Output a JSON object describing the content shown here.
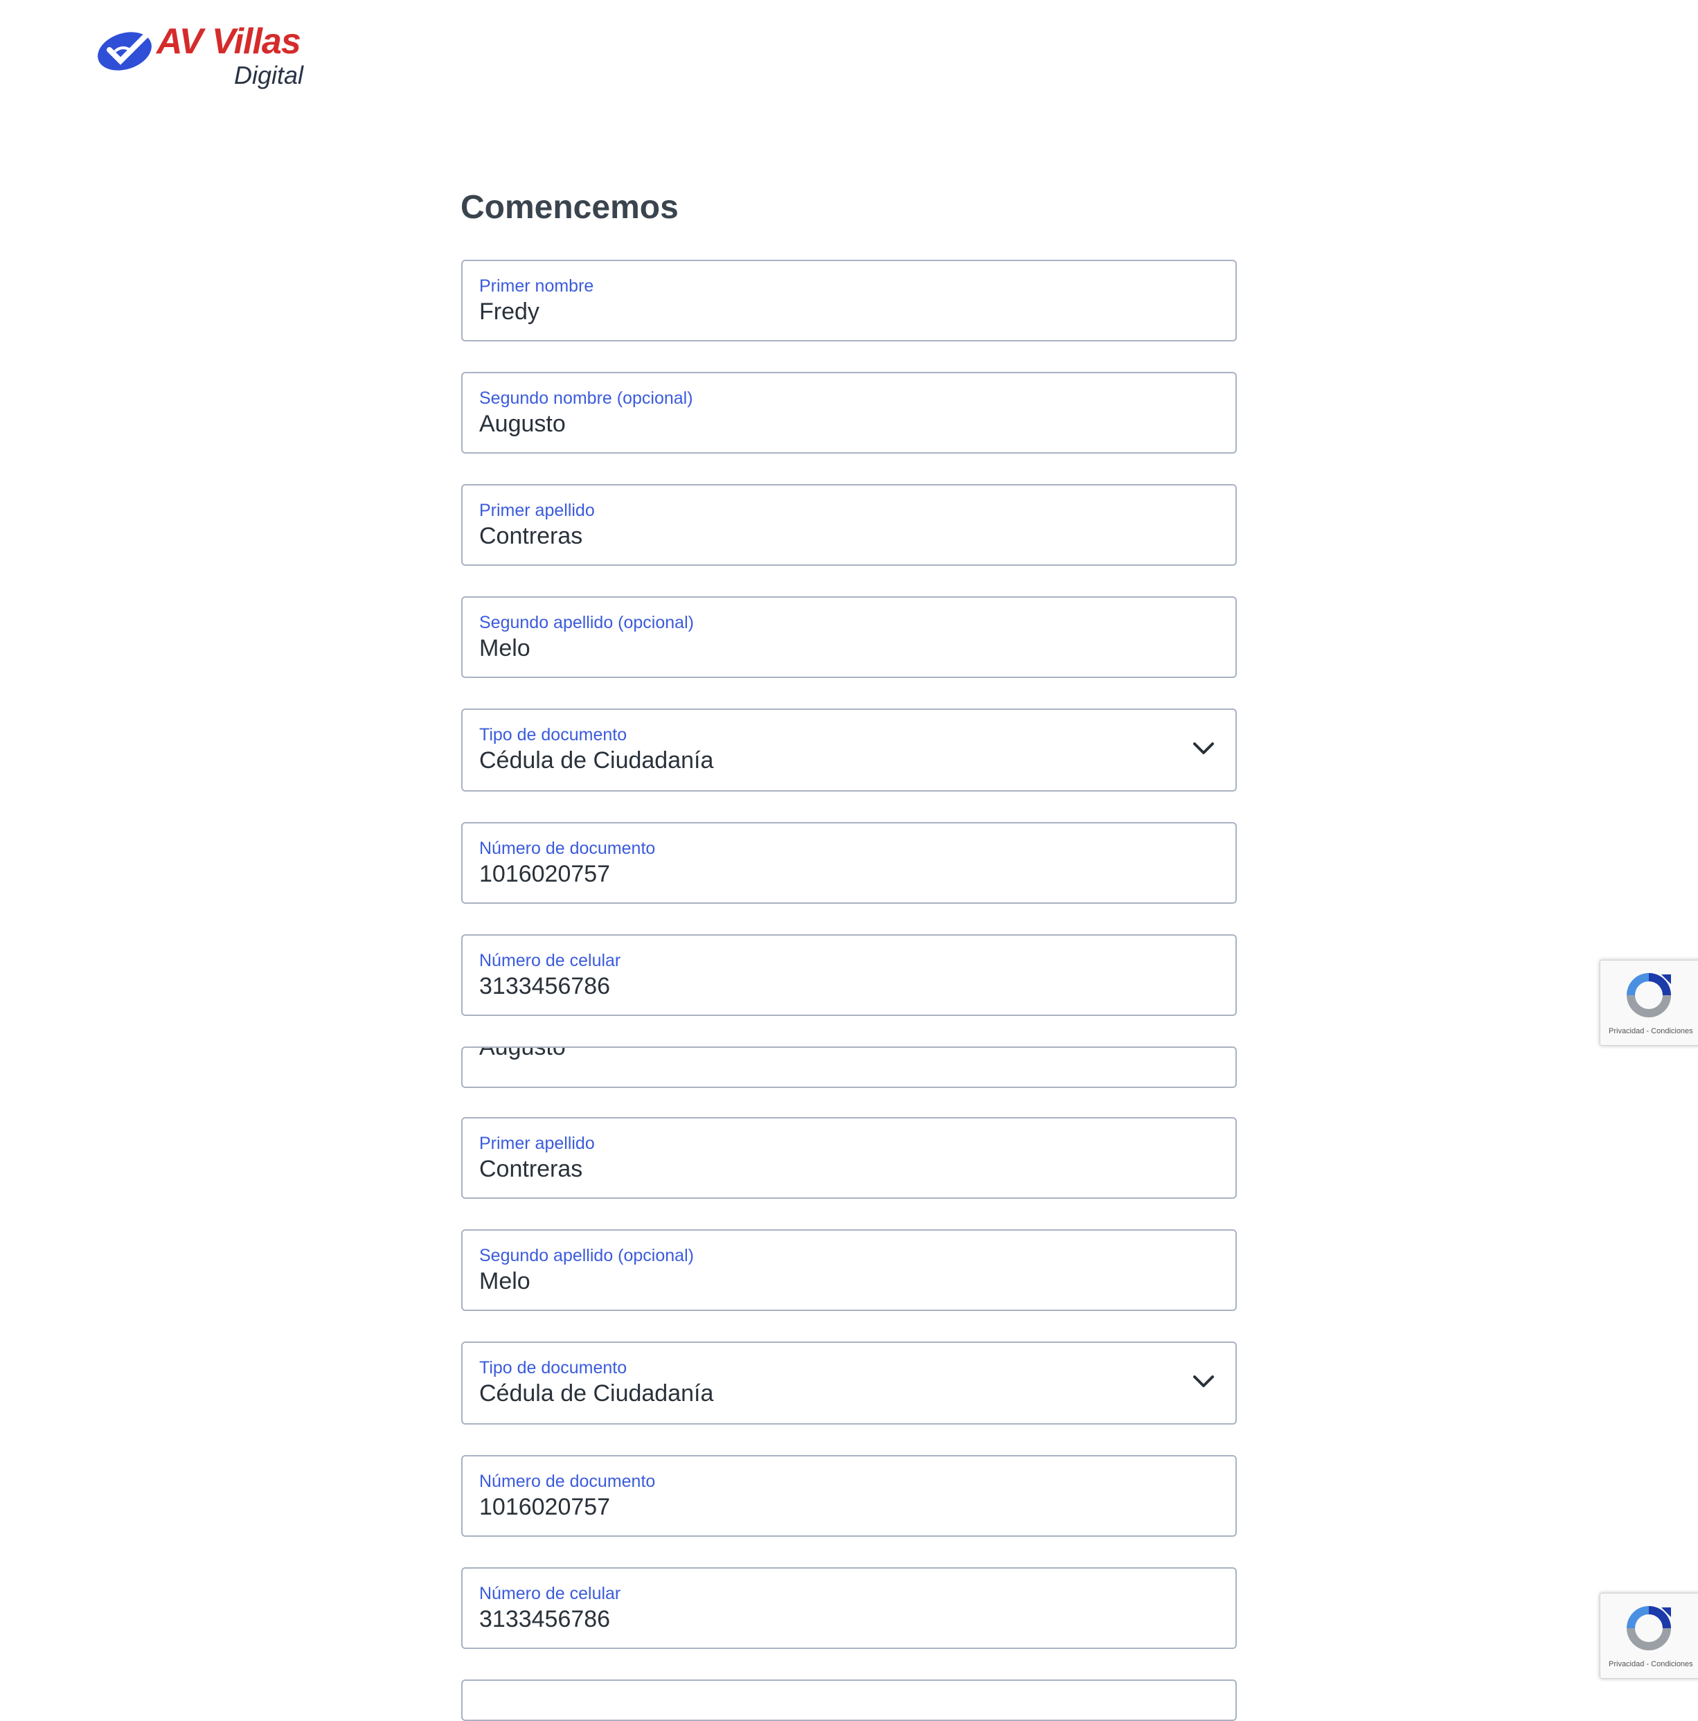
{
  "logo": {
    "brand": "AV Villas",
    "sub": "Digital",
    "icon": "av-villas-logo-icon"
  },
  "page": {
    "title": "Comencemos"
  },
  "fields": [
    {
      "label": "Primer nombre",
      "value": "Fredy"
    },
    {
      "label": "Segundo nombre (opcional)",
      "value": "Augusto"
    },
    {
      "label": "Primer apellido",
      "value": "Contreras"
    },
    {
      "label": "Segundo apellido (opcional)",
      "value": "Melo"
    },
    {
      "label": "Tipo de documento",
      "value": "Cédula de Ciudadanía",
      "icon": "chevron-down-icon"
    },
    {
      "label": "Número de documento",
      "value": "1016020757"
    },
    {
      "label": "Número de celular",
      "value": "3133456786"
    },
    {
      "label": "",
      "value": "Augusto"
    },
    {
      "label": "Primer apellido",
      "value": "Contreras"
    },
    {
      "label": "Segundo apellido (opcional)",
      "value": "Melo"
    },
    {
      "label": "Tipo de documento",
      "value": "Cédula de Ciudadanía",
      "icon": "chevron-down-icon"
    },
    {
      "label": "Número de documento",
      "value": "1016020757"
    },
    {
      "label": "Número de celular",
      "value": "3133456786"
    }
  ],
  "recaptcha": {
    "links": "Privacidad - Condiciones",
    "icon": "recaptcha-icon"
  },
  "colors": {
    "brand_red": "#d52b2b",
    "brand_blue": "#3b5bdb",
    "label_blue": "#3b5bdb",
    "border": "#a9b2c3"
  }
}
